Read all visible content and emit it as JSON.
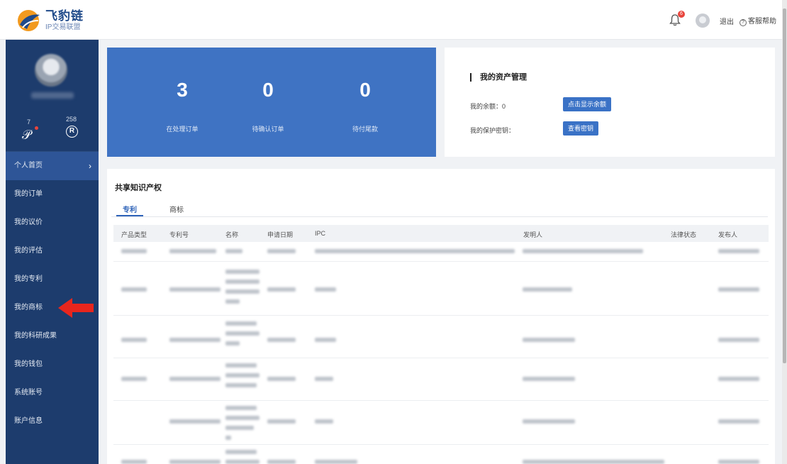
{
  "brand": {
    "title": "飞豹链",
    "subtitle": "IP交易联盟"
  },
  "header": {
    "bell_count": "6",
    "logout": "退出",
    "help": "客服帮助"
  },
  "sidebar": {
    "stats": [
      {
        "value": "7",
        "icon": "ip-icon"
      },
      {
        "value": "258",
        "icon": "registered-icon"
      }
    ],
    "items": [
      {
        "label": "个人首页",
        "active": true
      },
      {
        "label": "我的订单"
      },
      {
        "label": "我的议价"
      },
      {
        "label": "我的评估"
      },
      {
        "label": "我的专利"
      },
      {
        "label": "我的商标"
      },
      {
        "label": "我的科研成果"
      },
      {
        "label": "我的钱包"
      },
      {
        "label": "系统账号"
      },
      {
        "label": "账户信息"
      }
    ]
  },
  "order_stats": [
    {
      "value": "3",
      "label": "在处理订单"
    },
    {
      "value": "0",
      "label": "待确认订单"
    },
    {
      "value": "0",
      "label": "待付尾款"
    }
  ],
  "assets": {
    "title": "我的资产管理",
    "balance_label": "我的余额：0",
    "balance_button": "点击显示余额",
    "key_label": "我的保护密钥：",
    "key_button": "查看密钥"
  },
  "shared_ip": {
    "title": "共享知识产权",
    "tabs": [
      "专利",
      "商标"
    ],
    "columns": [
      "产品类型",
      "专利号",
      "名称",
      "申请日期",
      "IPC",
      "发明人",
      "法律状态",
      "发布人"
    ]
  },
  "colors": {
    "sidebar": "#1d3c6d",
    "accent": "#3f73c3",
    "arrow": "#e8261d"
  }
}
